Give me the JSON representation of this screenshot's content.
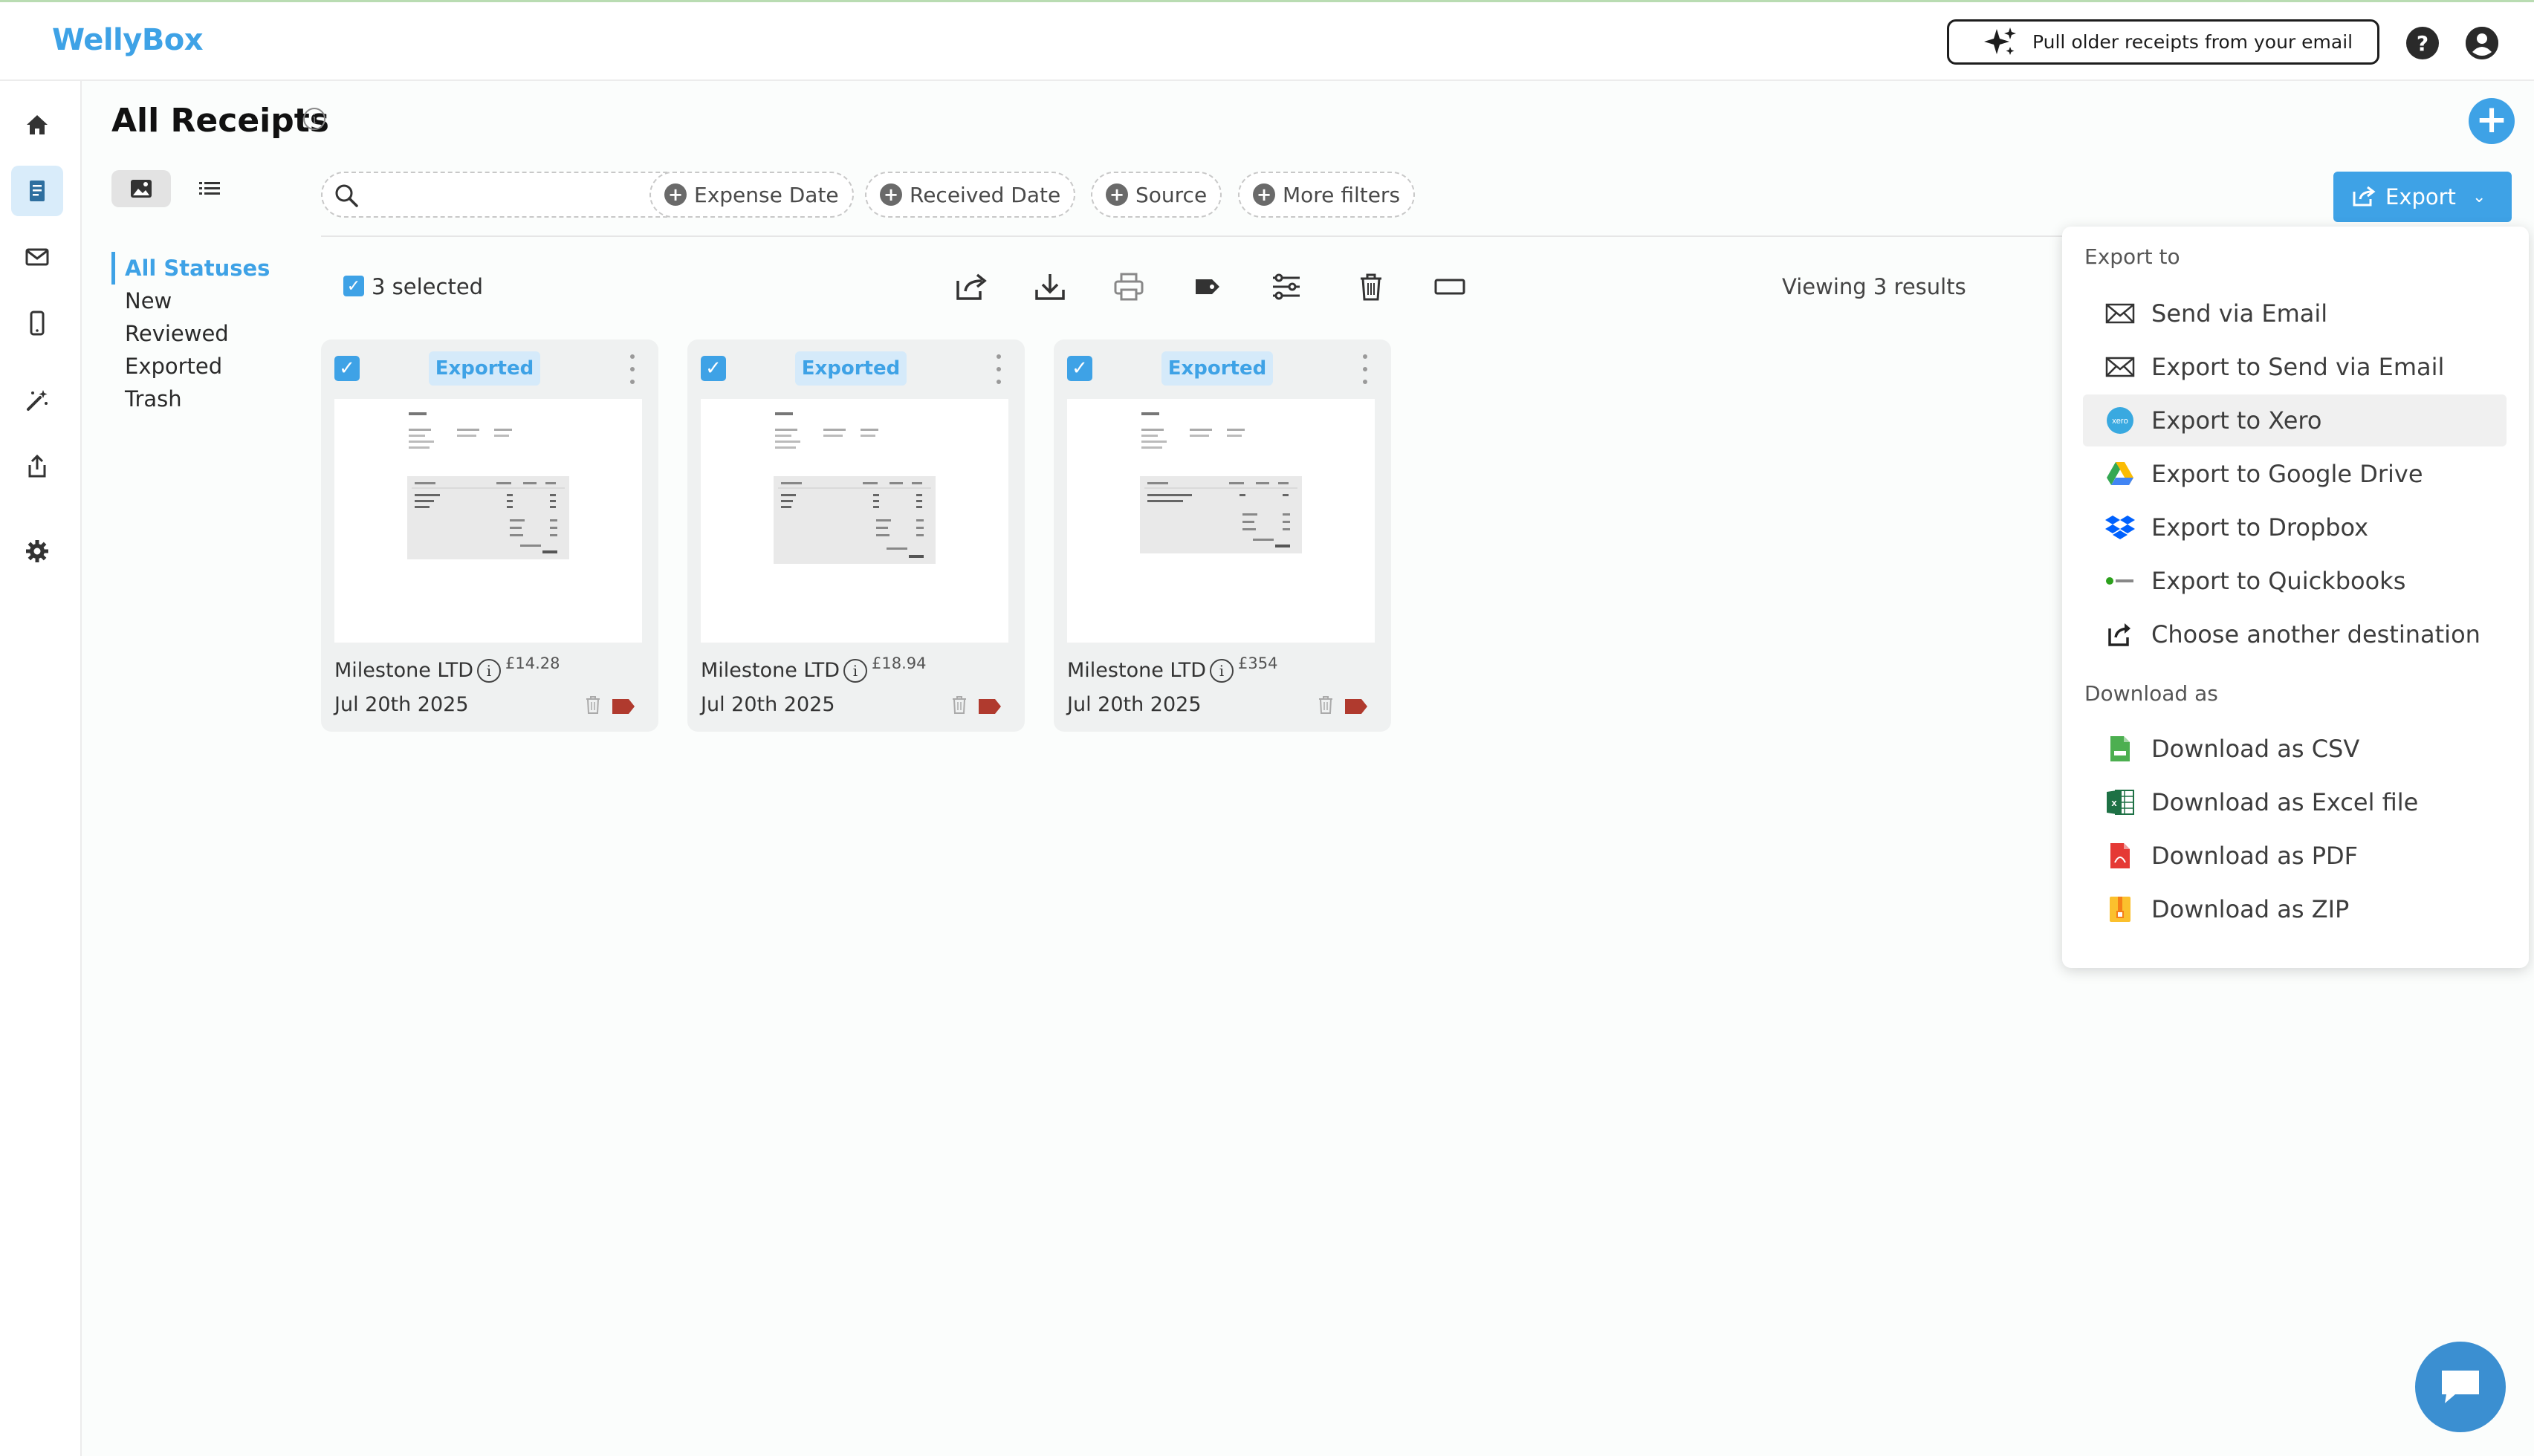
{
  "app": {
    "logo": "WellyBox"
  },
  "topbar": {
    "pull_label": "Pull older receipts from your email",
    "help_icon": "question-circle-icon",
    "account_icon": "user-circle-icon"
  },
  "page": {
    "title": "All Receipts"
  },
  "statuses": [
    "All Statuses",
    "New",
    "Reviewed",
    "Exported",
    "Trash"
  ],
  "search": {
    "placeholder": "",
    "value": ""
  },
  "filters": [
    "Expense Date",
    "Received Date",
    "Source",
    "More filters"
  ],
  "export_button": {
    "label": "Export"
  },
  "selection": {
    "label": "3 selected",
    "viewing": "Viewing 3 results"
  },
  "receipts": [
    {
      "badge": "Exported",
      "vendor": "Milestone LTD",
      "amount": "£14.28",
      "date": "Jul 20th 2025"
    },
    {
      "badge": "Exported",
      "vendor": "Milestone LTD",
      "amount": "£18.94",
      "date": "Jul 20th 2025"
    },
    {
      "badge": "Exported",
      "vendor": "Milestone LTD",
      "amount": "£354",
      "date": "Jul 20th 2025"
    }
  ],
  "export_menu": {
    "export_to_heading": "Export to",
    "export_to": [
      {
        "label": "Send via Email",
        "icon": "envelope-icon"
      },
      {
        "label": "Export to Send via Email",
        "icon": "envelope-icon"
      },
      {
        "label": "Export to Xero",
        "icon": "xero-icon"
      },
      {
        "label": "Export to Google Drive",
        "icon": "google-drive-icon"
      },
      {
        "label": "Export to Dropbox",
        "icon": "dropbox-icon"
      },
      {
        "label": "Export to Quickbooks",
        "icon": "quickbooks-icon"
      },
      {
        "label": "Choose another destination",
        "icon": "external-share-icon"
      }
    ],
    "download_heading": "Download as",
    "download_as": [
      {
        "label": "Download as CSV",
        "icon": "csv-file-icon"
      },
      {
        "label": "Download as Excel file",
        "icon": "excel-file-icon"
      },
      {
        "label": "Download as PDF",
        "icon": "pdf-file-icon"
      },
      {
        "label": "Download as ZIP",
        "icon": "zip-file-icon"
      }
    ]
  },
  "colors": {
    "accent": "#3ea2e6",
    "badge_bg": "#d5eafa",
    "tag": "#b03a2e",
    "chat": "#3b8fd1"
  }
}
